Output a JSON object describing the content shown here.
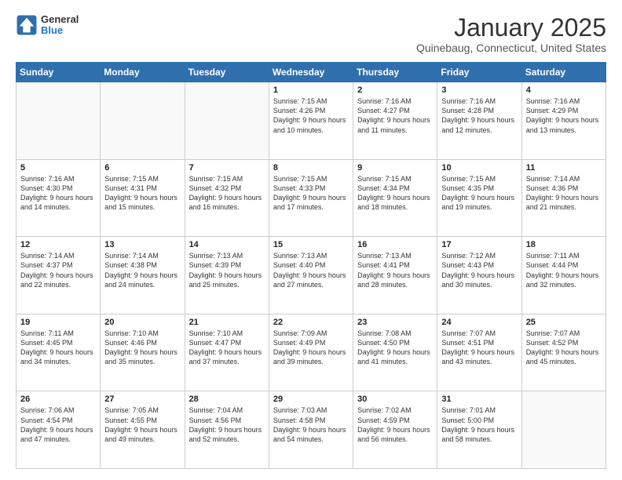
{
  "header": {
    "logo_general": "General",
    "logo_blue": "Blue",
    "month_title": "January 2025",
    "location": "Quinebaug, Connecticut, United States"
  },
  "weekdays": [
    "Sunday",
    "Monday",
    "Tuesday",
    "Wednesday",
    "Thursday",
    "Friday",
    "Saturday"
  ],
  "weeks": [
    [
      {
        "day": "",
        "empty": true
      },
      {
        "day": "",
        "empty": true
      },
      {
        "day": "",
        "empty": true
      },
      {
        "day": "1",
        "sunrise": "7:15 AM",
        "sunset": "4:26 PM",
        "daylight": "9 hours and 10 minutes."
      },
      {
        "day": "2",
        "sunrise": "7:16 AM",
        "sunset": "4:27 PM",
        "daylight": "9 hours and 11 minutes."
      },
      {
        "day": "3",
        "sunrise": "7:16 AM",
        "sunset": "4:28 PM",
        "daylight": "9 hours and 12 minutes."
      },
      {
        "day": "4",
        "sunrise": "7:16 AM",
        "sunset": "4:29 PM",
        "daylight": "9 hours and 13 minutes."
      }
    ],
    [
      {
        "day": "5",
        "sunrise": "7:16 AM",
        "sunset": "4:30 PM",
        "daylight": "9 hours and 14 minutes."
      },
      {
        "day": "6",
        "sunrise": "7:15 AM",
        "sunset": "4:31 PM",
        "daylight": "9 hours and 15 minutes."
      },
      {
        "day": "7",
        "sunrise": "7:15 AM",
        "sunset": "4:32 PM",
        "daylight": "9 hours and 16 minutes."
      },
      {
        "day": "8",
        "sunrise": "7:15 AM",
        "sunset": "4:33 PM",
        "daylight": "9 hours and 17 minutes."
      },
      {
        "day": "9",
        "sunrise": "7:15 AM",
        "sunset": "4:34 PM",
        "daylight": "9 hours and 18 minutes."
      },
      {
        "day": "10",
        "sunrise": "7:15 AM",
        "sunset": "4:35 PM",
        "daylight": "9 hours and 19 minutes."
      },
      {
        "day": "11",
        "sunrise": "7:14 AM",
        "sunset": "4:36 PM",
        "daylight": "9 hours and 21 minutes."
      }
    ],
    [
      {
        "day": "12",
        "sunrise": "7:14 AM",
        "sunset": "4:37 PM",
        "daylight": "9 hours and 22 minutes."
      },
      {
        "day": "13",
        "sunrise": "7:14 AM",
        "sunset": "4:38 PM",
        "daylight": "9 hours and 24 minutes."
      },
      {
        "day": "14",
        "sunrise": "7:13 AM",
        "sunset": "4:39 PM",
        "daylight": "9 hours and 25 minutes."
      },
      {
        "day": "15",
        "sunrise": "7:13 AM",
        "sunset": "4:40 PM",
        "daylight": "9 hours and 27 minutes."
      },
      {
        "day": "16",
        "sunrise": "7:13 AM",
        "sunset": "4:41 PM",
        "daylight": "9 hours and 28 minutes."
      },
      {
        "day": "17",
        "sunrise": "7:12 AM",
        "sunset": "4:43 PM",
        "daylight": "9 hours and 30 minutes."
      },
      {
        "day": "18",
        "sunrise": "7:11 AM",
        "sunset": "4:44 PM",
        "daylight": "9 hours and 32 minutes."
      }
    ],
    [
      {
        "day": "19",
        "sunrise": "7:11 AM",
        "sunset": "4:45 PM",
        "daylight": "9 hours and 34 minutes."
      },
      {
        "day": "20",
        "sunrise": "7:10 AM",
        "sunset": "4:46 PM",
        "daylight": "9 hours and 35 minutes."
      },
      {
        "day": "21",
        "sunrise": "7:10 AM",
        "sunset": "4:47 PM",
        "daylight": "9 hours and 37 minutes."
      },
      {
        "day": "22",
        "sunrise": "7:09 AM",
        "sunset": "4:49 PM",
        "daylight": "9 hours and 39 minutes."
      },
      {
        "day": "23",
        "sunrise": "7:08 AM",
        "sunset": "4:50 PM",
        "daylight": "9 hours and 41 minutes."
      },
      {
        "day": "24",
        "sunrise": "7:07 AM",
        "sunset": "4:51 PM",
        "daylight": "9 hours and 43 minutes."
      },
      {
        "day": "25",
        "sunrise": "7:07 AM",
        "sunset": "4:52 PM",
        "daylight": "9 hours and 45 minutes."
      }
    ],
    [
      {
        "day": "26",
        "sunrise": "7:06 AM",
        "sunset": "4:54 PM",
        "daylight": "9 hours and 47 minutes."
      },
      {
        "day": "27",
        "sunrise": "7:05 AM",
        "sunset": "4:55 PM",
        "daylight": "9 hours and 49 minutes."
      },
      {
        "day": "28",
        "sunrise": "7:04 AM",
        "sunset": "4:56 PM",
        "daylight": "9 hours and 52 minutes."
      },
      {
        "day": "29",
        "sunrise": "7:03 AM",
        "sunset": "4:58 PM",
        "daylight": "9 hours and 54 minutes."
      },
      {
        "day": "30",
        "sunrise": "7:02 AM",
        "sunset": "4:59 PM",
        "daylight": "9 hours and 56 minutes."
      },
      {
        "day": "31",
        "sunrise": "7:01 AM",
        "sunset": "5:00 PM",
        "daylight": "9 hours and 58 minutes."
      },
      {
        "day": "",
        "empty": true
      }
    ]
  ]
}
